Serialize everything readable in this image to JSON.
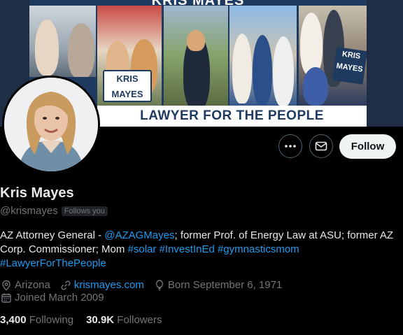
{
  "banner": {
    "headline": "KRIS MAYES",
    "sign_text": "KRIS MAYES",
    "sign2_text": "KRIS MAYES",
    "tagline": "LAWYER FOR THE PEOPLE"
  },
  "actions": {
    "more_icon": "ellipsis-icon",
    "message_icon": "envelope-icon",
    "follow_label": "Follow"
  },
  "profile": {
    "name": "Kris Mayes",
    "handle": "@krismayes",
    "follows_you": "Follows you",
    "bio_prefix": "AZ Attorney General - ",
    "bio_mention": "@AZAGMayes",
    "bio_middle": "; former Prof. of Energy Law at ASU; former AZ Corp. Commissioner; Mom ",
    "hashtags": [
      "#solar",
      "#InvestInEd",
      "#gymnasticsmom",
      "#LawyerForThePeople"
    ],
    "location": "Arizona",
    "website": "krismayes.com",
    "birthday": "Born September 6, 1971",
    "joined": "Joined March 2009"
  },
  "stats": {
    "following_count": "3,400",
    "following_label": "Following",
    "followers_count": "30.9K",
    "followers_label": "Followers"
  },
  "colors": {
    "background": "#000000",
    "text": "#e7e9ea",
    "secondary": "#71767b",
    "link": "#1d9bf0",
    "banner_navy": "#1e3a5f"
  }
}
